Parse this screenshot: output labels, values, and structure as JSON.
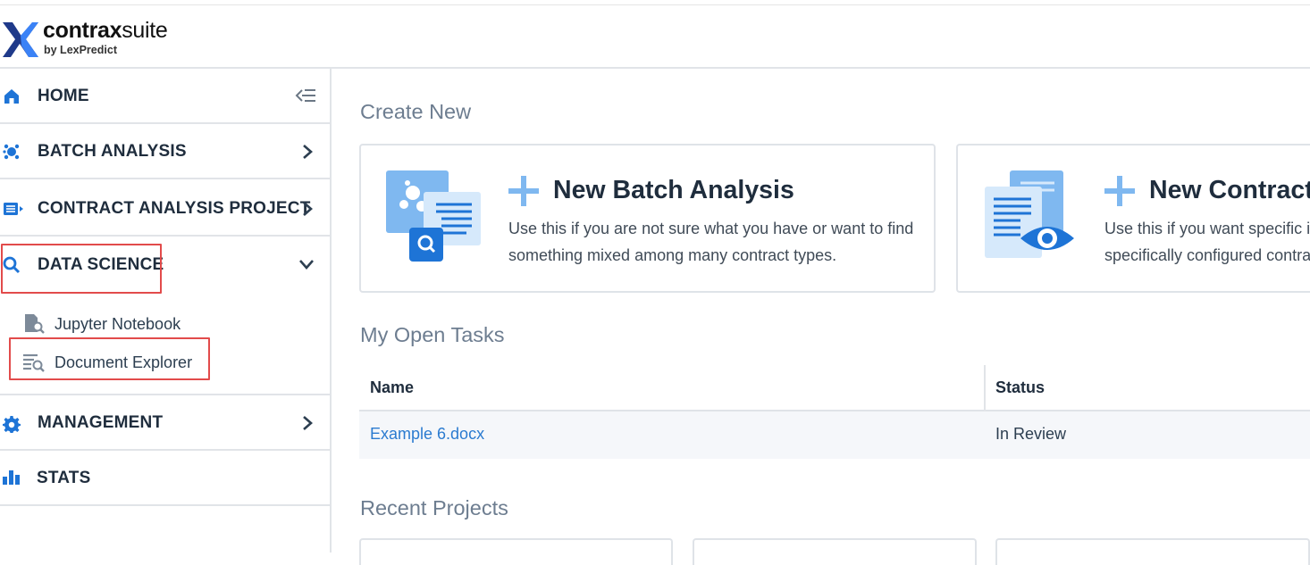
{
  "app": {
    "brand_bold": "contrax",
    "brand_light": "suite",
    "brand_sub": "by LexPredict"
  },
  "colors": {
    "accent": "#2b7bd0",
    "icon_blue": "#1e74d6",
    "light_blue": "#7fb8f0",
    "highlight_red": "#e24b4b",
    "logo_dark": "#1f3a8a",
    "logo_light": "#3b82f6"
  },
  "sidebar": {
    "items": [
      {
        "label": "HOME",
        "icon": "home-icon",
        "trail_icon": "collapse-sidebar-icon"
      },
      {
        "label": "BATCH ANALYSIS",
        "icon": "batch-analysis-icon",
        "trail_icon": "chevron-right-icon"
      },
      {
        "label": "CONTRACT ANALYSIS PROJECT",
        "icon": "contract-project-icon",
        "trail_icon": "chevron-right-icon"
      },
      {
        "label": "DATA SCIENCE",
        "icon": "search-icon",
        "trail_icon": "chevron-down-icon",
        "highlighted": true
      },
      {
        "label": "MANAGEMENT",
        "icon": "gear-icon",
        "trail_icon": "chevron-right-icon"
      },
      {
        "label": "STATS",
        "icon": "bar-chart-icon"
      }
    ],
    "data_science_children": [
      {
        "label": "Jupyter Notebook",
        "icon": "notebook-search-icon"
      },
      {
        "label": "Document Explorer",
        "icon": "document-explorer-icon",
        "highlighted": true
      }
    ]
  },
  "main": {
    "create_new_title": "Create New",
    "cards": [
      {
        "title": "New Batch Analysis",
        "description": "Use this if you are not sure what you have or want to find something mixed among many contract types.",
        "icon": "batch-analysis-illustration"
      },
      {
        "title": "New Contract",
        "description": "Use this if you want specific i specifically configured contra",
        "icon": "contract-review-illustration"
      }
    ],
    "open_tasks_title": "My Open Tasks",
    "tasks_table": {
      "columns": [
        "Name",
        "Status"
      ],
      "rows": [
        {
          "name": "Example 6.docx",
          "status": "In Review"
        }
      ]
    },
    "recent_projects_title": "Recent Projects"
  }
}
